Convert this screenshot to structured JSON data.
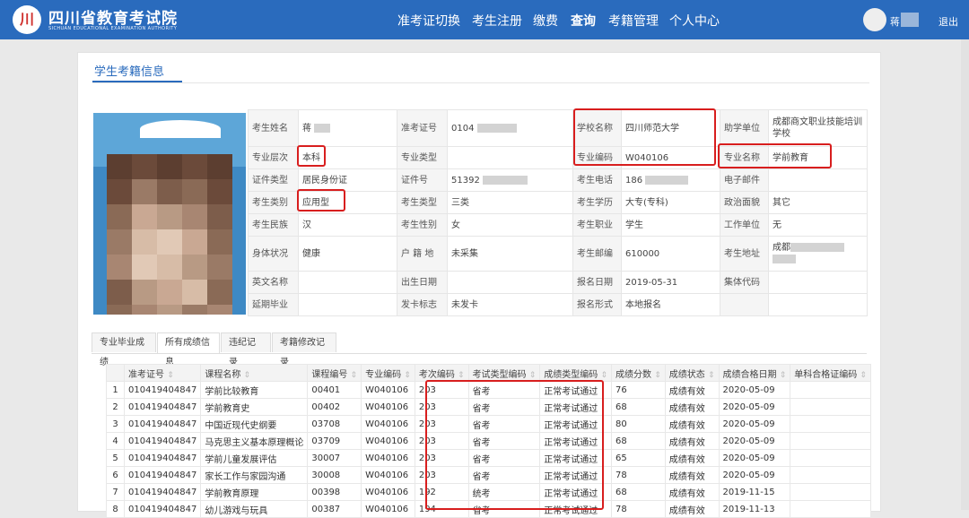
{
  "header": {
    "logo_char": "川",
    "brand": "四川省教育考试院",
    "brand_sub": "SICHUAN EDUCATIONAL EXAMINATION AUTHORITY",
    "nav": [
      "准考证切换",
      "考生注册",
      "缴费",
      "查询",
      "考籍管理",
      "个人中心"
    ],
    "active_nav": "查询",
    "user": "蒋",
    "logout": "退出"
  },
  "section": {
    "title": "学生考籍信息"
  },
  "info": {
    "name_label": "考生姓名",
    "name_value": "蒋",
    "ticket_label": "准考证号",
    "ticket_value": "0104",
    "school_label": "学校名称",
    "school_value": "四川师范大学",
    "assist_label": "助学单位",
    "assist_value": "成都商文职业技能培训学校",
    "level_label": "专业层次",
    "level_value": "本科",
    "type_label": "专业类型",
    "type_value": "",
    "code_label": "专业编码",
    "code_value": "W040106",
    "major_label": "专业名称",
    "major_value": "学前教育",
    "idtype_label": "证件类型",
    "idtype_value": "居民身份证",
    "idno_label": "证件号",
    "idno_value": "51392",
    "phone_label": "考生电话",
    "phone_value": "186",
    "email_label": "电子邮件",
    "email_value": "",
    "category_label": "考生类别",
    "category_value": "应用型",
    "examtype_label": "考生类型",
    "examtype_value": "三类",
    "edu_label": "考生学历",
    "edu_value": "大专(专科)",
    "politics_label": "政治面貌",
    "politics_value": "其它",
    "ethnic_label": "考生民族",
    "ethnic_value": "汉",
    "gender_label": "考生性别",
    "gender_value": "女",
    "job_label": "考生职业",
    "job_value": "学生",
    "work_label": "工作单位",
    "work_value": "无",
    "health_label": "身体状况",
    "health_value": "健康",
    "hukou_label": "户 籍 地",
    "hukou_value": "未采集",
    "zip_label": "考生邮编",
    "zip_value": "610000",
    "address_label": "考生地址",
    "address_value": "成都",
    "engname_label": "英文名称",
    "engname_value": "",
    "birth_label": "出生日期",
    "birth_value": "",
    "regdate_label": "报名日期",
    "regdate_value": "2019-05-31",
    "group_label": "集体代码",
    "group_value": "",
    "delay_label": "延期毕业",
    "delay_value": "",
    "card_label": "发卡标志",
    "card_value": "未发卡",
    "regform_label": "报名形式",
    "regform_value": "本地报名"
  },
  "tabs": [
    "专业毕业成绩",
    "所有成绩信息",
    "违纪记录",
    "考籍修改记录"
  ],
  "active_tab": "所有成绩信息",
  "scores": {
    "headers": [
      "准考证号",
      "课程名称",
      "课程编号",
      "专业编码",
      "考次编码",
      "考试类型编码",
      "成绩类型编码",
      "成绩分数",
      "成绩状态",
      "成绩合格日期",
      "单科合格证编码"
    ],
    "rows": [
      [
        "1",
        "010419404847",
        "学前比较教育",
        "00401",
        "W040106",
        "203",
        "省考",
        "正常考试通过",
        "76",
        "成绩有效",
        "2020-05-09",
        ""
      ],
      [
        "2",
        "010419404847",
        "学前教育史",
        "00402",
        "W040106",
        "203",
        "省考",
        "正常考试通过",
        "68",
        "成绩有效",
        "2020-05-09",
        ""
      ],
      [
        "3",
        "010419404847",
        "中国近现代史纲要",
        "03708",
        "W040106",
        "203",
        "省考",
        "正常考试通过",
        "80",
        "成绩有效",
        "2020-05-09",
        ""
      ],
      [
        "4",
        "010419404847",
        "马克思主义基本原理概论",
        "03709",
        "W040106",
        "203",
        "省考",
        "正常考试通过",
        "68",
        "成绩有效",
        "2020-05-09",
        ""
      ],
      [
        "5",
        "010419404847",
        "学前儿童发展评估",
        "30007",
        "W040106",
        "203",
        "省考",
        "正常考试通过",
        "65",
        "成绩有效",
        "2020-05-09",
        ""
      ],
      [
        "6",
        "010419404847",
        "家长工作与家园沟通",
        "30008",
        "W040106",
        "203",
        "省考",
        "正常考试通过",
        "78",
        "成绩有效",
        "2020-05-09",
        ""
      ],
      [
        "7",
        "010419404847",
        "学前教育原理",
        "00398",
        "W040106",
        "192",
        "统考",
        "正常考试通过",
        "68",
        "成绩有效",
        "2019-11-15",
        ""
      ],
      [
        "8",
        "010419404847",
        "幼儿游戏与玩具",
        "00387",
        "W040106",
        "194",
        "省考",
        "正常考试通过",
        "78",
        "成绩有效",
        "2019-11-13",
        ""
      ]
    ]
  }
}
